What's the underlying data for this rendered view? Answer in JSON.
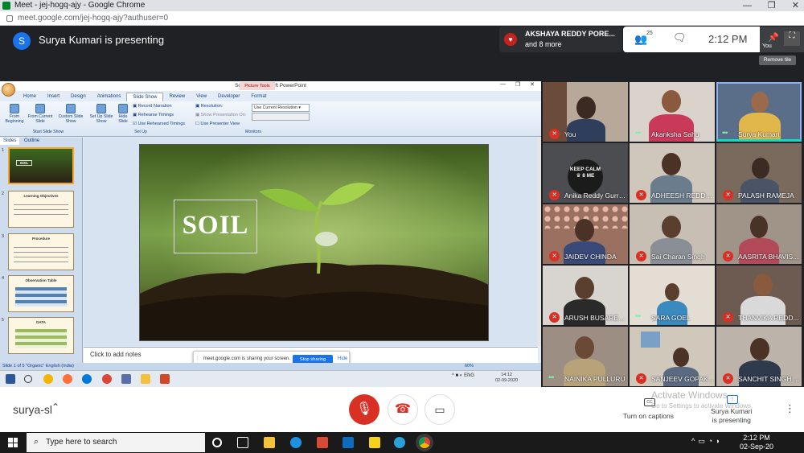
{
  "browser": {
    "window_title": "Meet - jej-hogq-ajy - Google Chrome",
    "url": "meet.google.com/jej-hogq-ajy?authuser=0"
  },
  "meet": {
    "presenter_initial": "S",
    "presenting_title": "Surya Kumari is presenting",
    "notification": {
      "name": "AKSHAYA REDDY PORE...",
      "more": "and 8 more"
    },
    "people_count": "25",
    "time": "2:12 PM",
    "self_tile_label": "You",
    "remove_tile_tooltip": "Remove tile",
    "meeting_code": "surya-sl",
    "captions_label": "Turn on captions",
    "captions_icon_text": "CC",
    "presenting_status": {
      "line1": "Surya Kumari",
      "line2": "is presenting"
    },
    "watermark": {
      "line1": "Activate Windows",
      "line2": "Go to Settings to activate Windows."
    }
  },
  "powerpoint": {
    "window_title": "Soil ppt - Microsoft PowerPoint",
    "contextual_tab": "Picture Tools",
    "tabs": [
      "Home",
      "Insert",
      "Design",
      "Animations",
      "Slide Show",
      "Review",
      "View",
      "Developer",
      "Format"
    ],
    "active_tab": "Slide Show",
    "ribbon": {
      "from_beginning": "From Beginning",
      "from_current": "From Current Slide",
      "custom_show": "Custom Slide Show",
      "setup_show": "Set Up Slide Show",
      "hide_slide": "Hide Slide",
      "record_narration": "Record Narration",
      "rehearse_timings": "Rehearse Timings",
      "use_rehearsed": "Use Rehearsed Timings",
      "resolution_label": "Resolution:",
      "resolution_value": "Use Current Resolution",
      "show_on": "Show Presentation On:",
      "presenter_view": "Use Presenter View",
      "group_start": "Start Slide Show",
      "group_setup": "Set Up",
      "group_monitors": "Monitors"
    },
    "panel_tabs": [
      "Slides",
      "Outline"
    ],
    "thumbnails": [
      {
        "num": "1",
        "title": "SOIL"
      },
      {
        "num": "2",
        "title": "Learning Objectives"
      },
      {
        "num": "3",
        "title": "Procedure"
      },
      {
        "num": "4",
        "title": "Observation Table"
      },
      {
        "num": "5",
        "title": "DATA"
      }
    ],
    "slide_title": "SOIL",
    "notes_placeholder": "Click to add notes",
    "status": "Slide 1 of 5    \"Organic\"    English (India)",
    "zoom": "60%",
    "share_banner": {
      "message": "meet.google.com is sharing your screen.",
      "stop": "Stop sharing",
      "hide": "Hide"
    },
    "inner_tray": "ENG",
    "inner_clock": {
      "time": "14:12",
      "date": "02-09-2020"
    }
  },
  "participants": [
    {
      "name": "You",
      "muted": true
    },
    {
      "name": "Akanksha Sahu",
      "muted": false
    },
    {
      "name": "Surya Kumari",
      "muted": false
    },
    {
      "name": "Anika Reddy Gurra...",
      "muted": true
    },
    {
      "name": "ADHEESH REDDY ...",
      "muted": true
    },
    {
      "name": "PALASH RAMEJA",
      "muted": true
    },
    {
      "name": "JAIDEV CHINDA",
      "muted": true
    },
    {
      "name": "Sai Charan Singh",
      "muted": true
    },
    {
      "name": "AASRITA BHAVIS...",
      "muted": true
    },
    {
      "name": "ARUSH BUSARED...",
      "muted": true
    },
    {
      "name": "SARA GOEL",
      "muted": false
    },
    {
      "name": "THANVIKA REDD...",
      "muted": true
    },
    {
      "name": "NAINIKA PULLURU",
      "muted": false
    },
    {
      "name": "SANJEEV GOPAK...",
      "muted": true
    },
    {
      "name": "SANCHIT SINGH ...",
      "muted": true
    }
  ],
  "keep_calm_text": "KEEP CALM ♛ 8 ME",
  "taskbar": {
    "search_placeholder": "Type here to search",
    "time": "2:12 PM",
    "date": "02-Sep-20"
  }
}
